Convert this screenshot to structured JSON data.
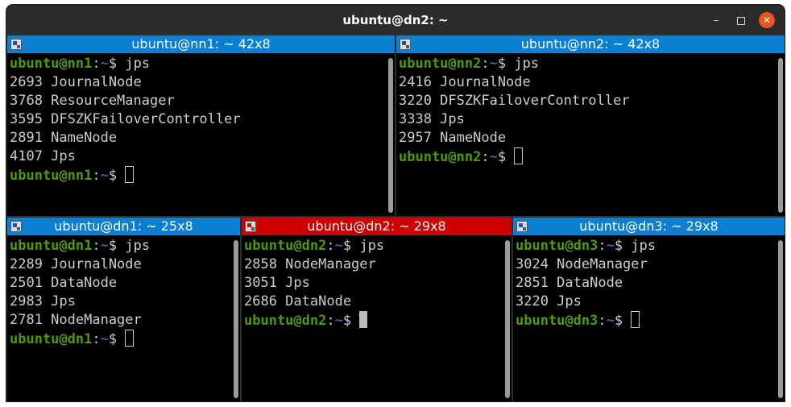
{
  "window": {
    "title": "ubuntu@dn2: ~",
    "min_glyph": "–",
    "close_glyph": "✕",
    "accent_close": "#e95420"
  },
  "colors": {
    "header_inactive": "#0c7fd3",
    "header_active": "#cc0000",
    "prompt_user": "#4e9a06",
    "prompt_path": "#3465a4",
    "text": "#cccccc"
  },
  "panes": {
    "nn1": {
      "header": "ubuntu@nn1: ~ 42x8",
      "prompt_user": "ubuntu@nn1",
      "command": "jps",
      "output": [
        "2693 JournalNode",
        "3768 ResourceManager",
        "3595 DFSZKFailoverController",
        "2891 NameNode",
        "4107 Jps"
      ]
    },
    "nn2": {
      "header": "ubuntu@nn2: ~ 42x8",
      "prompt_user": "ubuntu@nn2",
      "command": "jps",
      "output": [
        "2416 JournalNode",
        "3220 DFSZKFailoverController",
        "3338 Jps",
        "2957 NameNode"
      ]
    },
    "dn1": {
      "header": "ubuntu@dn1: ~ 25x8",
      "prompt_user": "ubuntu@dn1",
      "command": "jps",
      "output": [
        "2289 JournalNode",
        "2501 DataNode",
        "2983 Jps",
        "2781 NodeManager"
      ]
    },
    "dn2": {
      "header": "ubuntu@dn2: ~ 29x8",
      "prompt_user": "ubuntu@dn2",
      "command": "jps",
      "output": [
        "2858 NodeManager",
        "3051 Jps",
        "2686 DataNode"
      ]
    },
    "dn3": {
      "header": "ubuntu@dn3: ~ 29x8",
      "prompt_user": "ubuntu@dn3",
      "command": "jps",
      "output": [
        "3024 NodeManager",
        "2851 DataNode",
        "3220 Jps"
      ]
    }
  },
  "prompt": {
    "sep": ":",
    "path": "~",
    "symbol": "$ "
  }
}
